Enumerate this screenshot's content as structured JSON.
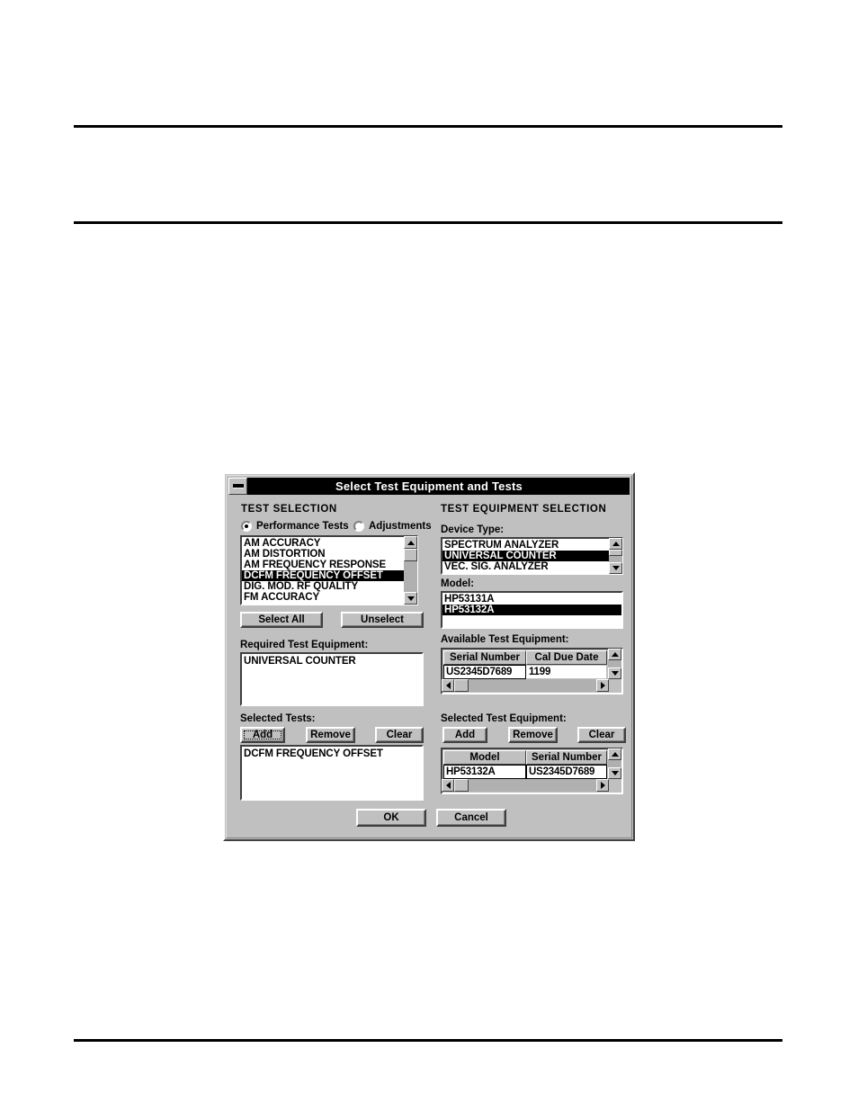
{
  "dialog": {
    "title": "Select Test Equipment and Tests",
    "sysmenu_icon": "minimize-box-icon",
    "left_panel": {
      "heading": "TEST SELECTION",
      "radios": [
        {
          "label": "Performance Tests",
          "checked": true
        },
        {
          "label": "Adjustments",
          "checked": false
        }
      ],
      "test_list": {
        "items": [
          {
            "label": "AM ACCURACY",
            "selected": false
          },
          {
            "label": "AM DISTORTION",
            "selected": false
          },
          {
            "label": "AM FREQUENCY RESPONSE",
            "selected": false
          },
          {
            "label": "DCFM FREQUENCY OFFSET",
            "selected": true
          },
          {
            "label": "DIG. MOD. RF QUALITY",
            "selected": false
          },
          {
            "label": "FM ACCURACY",
            "selected": false
          }
        ]
      },
      "select_all_label": "Select All",
      "unselect_label": "Unselect",
      "required_equipment_label": "Required Test Equipment:",
      "required_equipment_items": [
        "UNIVERSAL COUNTER"
      ],
      "selected_tests_label": "Selected Tests:",
      "add_label": "Add",
      "remove_label": "Remove",
      "clear_label": "Clear",
      "selected_tests_items": [
        "DCFM FREQUENCY OFFSET"
      ]
    },
    "right_panel": {
      "heading": "TEST EQUIPMENT SELECTION",
      "device_type_label": "Device Type:",
      "device_type_items": [
        {
          "label": "SPECTRUM ANALYZER",
          "selected": false
        },
        {
          "label": "UNIVERSAL COUNTER",
          "selected": true
        },
        {
          "label": "VEC. SIG. ANALYZER",
          "selected": false
        }
      ],
      "model_label": "Model:",
      "model_items": [
        {
          "label": "HP53131A",
          "selected": false
        },
        {
          "label": "HP53132A",
          "selected": true
        }
      ],
      "available_label": "Available Test Equipment:",
      "available_grid": {
        "columns": [
          "Serial Number",
          "Cal Due Date"
        ],
        "rows": [
          [
            "US2345D7689",
            "1199"
          ]
        ]
      },
      "selected_label": "Selected Test Equipment:",
      "add_label": "Add",
      "remove_label": "Remove",
      "clear_label": "Clear",
      "selected_grid": {
        "columns": [
          "Model",
          "Serial Number"
        ],
        "rows": [
          [
            "HP53132A",
            "US2345D7689"
          ]
        ]
      }
    },
    "ok_label": "OK",
    "cancel_label": "Cancel"
  },
  "colors": {
    "dialog_face": "#c0c0c0",
    "titlebar": "#000000",
    "titlebar_text": "#ffffff",
    "selection_bg": "#000000",
    "selection_fg": "#ffffff",
    "field_bg": "#ffffff",
    "page_bg": "#ffffff",
    "rule": "#000000"
  }
}
